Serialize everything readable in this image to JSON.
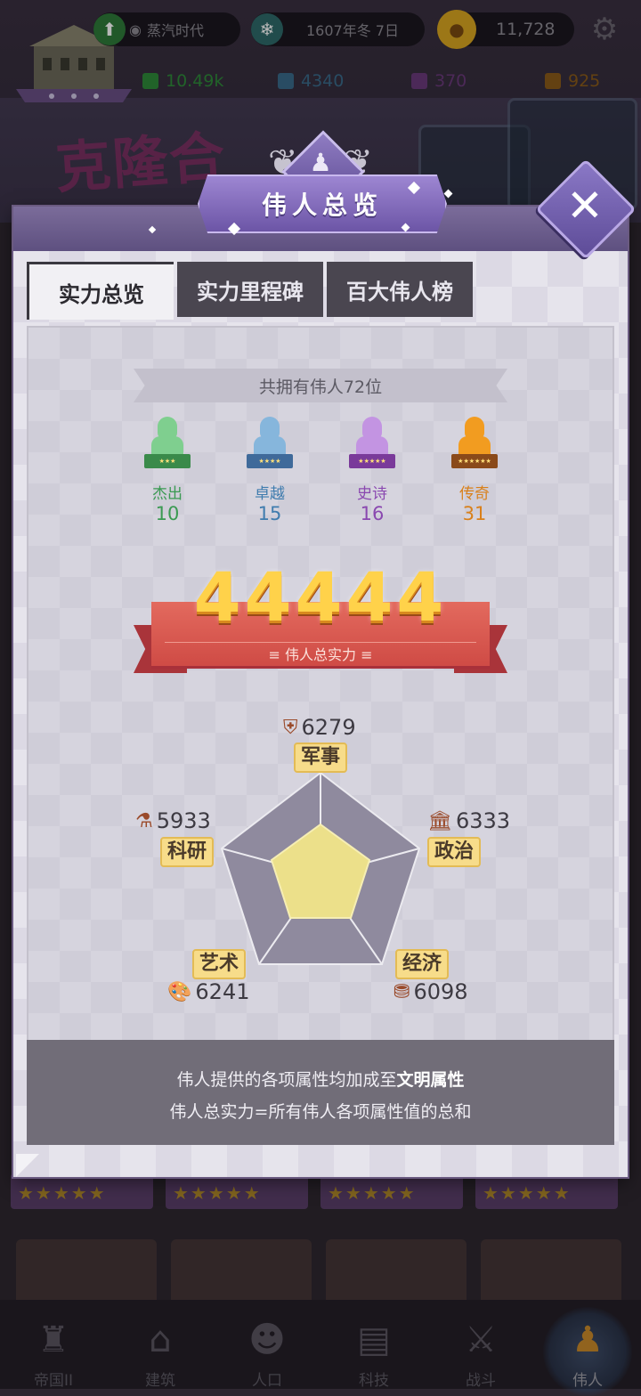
{
  "hud": {
    "era": "蒸汽时代",
    "date": "1607年冬 7日",
    "gold": "11,728",
    "resources": [
      {
        "value": "10.49k",
        "color": "#2f8a3a"
      },
      {
        "value": "4340",
        "color": "#3a6a8a"
      },
      {
        "value": "370",
        "color": "#6a3a7a"
      },
      {
        "value": "925",
        "color": "#8a5a1a"
      }
    ],
    "bg_title": "克隆合"
  },
  "modal": {
    "title": "伟人总览",
    "tabs": [
      "实力总览",
      "实力里程碑",
      "百大伟人榜"
    ],
    "total_banner": "共拥有伟人72位",
    "tiers": [
      {
        "name": "杰出",
        "count": "10",
        "color": "#3a9a52",
        "bust": "#7fcf8f",
        "stars": "★★★"
      },
      {
        "name": "卓越",
        "count": "15",
        "color": "#3f7cae",
        "bust": "#86b6dc",
        "stars": "★★★★"
      },
      {
        "name": "史诗",
        "count": "16",
        "color": "#8a48b0",
        "bust": "#c394e2",
        "stars": "★★★★★"
      },
      {
        "name": "传奇",
        "count": "31",
        "color": "#d9801a",
        "bust": "#f29c20",
        "stars": "★★★★★★"
      }
    ],
    "total_power": "44444",
    "total_power_label": "伟人总实力",
    "attributes": {
      "military": {
        "label": "军事",
        "value": "6279",
        "icon": "shield-icon"
      },
      "politics": {
        "label": "政治",
        "value": "6333",
        "icon": "bank-icon"
      },
      "economy": {
        "label": "经济",
        "value": "6098",
        "icon": "coins-icon"
      },
      "art": {
        "label": "艺术",
        "value": "6241",
        "icon": "palette-icon"
      },
      "research": {
        "label": "科研",
        "value": "5933",
        "icon": "flask-icon"
      }
    },
    "info_line1_prefix": "伟人提供的各项属性均加成至",
    "info_line1_bold": "文明属性",
    "info_line2": "伟人总实力=所有伟人各项属性值的总和"
  },
  "nav": [
    {
      "label": "帝国II",
      "icon": "castle-icon"
    },
    {
      "label": "建筑",
      "icon": "house-icon"
    },
    {
      "label": "人口",
      "icon": "person-icon"
    },
    {
      "label": "科技",
      "icon": "book-icon"
    },
    {
      "label": "战斗",
      "icon": "swords-icon"
    },
    {
      "label": "伟人",
      "icon": "bust-icon",
      "active": true
    }
  ]
}
